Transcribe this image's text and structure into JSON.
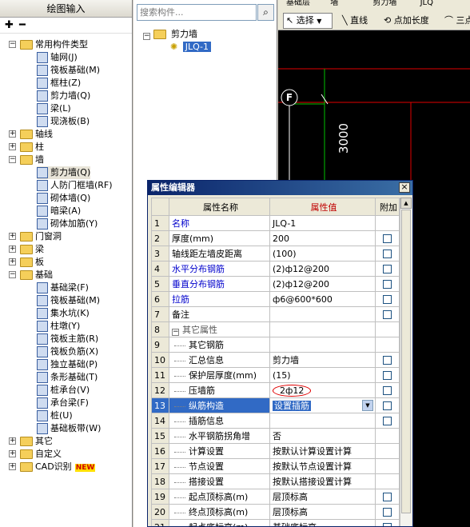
{
  "left_panel": {
    "title": "绘图输入",
    "tree": [
      {
        "level": 0,
        "type": "folder",
        "label": "常用构件类型",
        "expanded": true
      },
      {
        "level": 1,
        "type": "item",
        "label": "轴网(J)"
      },
      {
        "level": 1,
        "type": "item",
        "label": "筏板基础(M)"
      },
      {
        "level": 1,
        "type": "item",
        "label": "框柱(Z)"
      },
      {
        "level": 1,
        "type": "item",
        "label": "剪力墙(Q)"
      },
      {
        "level": 1,
        "type": "item",
        "label": "梁(L)"
      },
      {
        "level": 1,
        "type": "item",
        "label": "现浇板(B)"
      },
      {
        "level": 0,
        "type": "folder",
        "label": "轴线",
        "expanded": false
      },
      {
        "level": 0,
        "type": "folder",
        "label": "柱",
        "expanded": false
      },
      {
        "level": 0,
        "type": "folder",
        "label": "墙",
        "expanded": true
      },
      {
        "level": 1,
        "type": "item",
        "label": "剪力墙(Q)",
        "selected": true
      },
      {
        "level": 1,
        "type": "item",
        "label": "人防门框墙(RF)"
      },
      {
        "level": 1,
        "type": "item",
        "label": "砌体墙(Q)"
      },
      {
        "level": 1,
        "type": "item",
        "label": "暗梁(A)"
      },
      {
        "level": 1,
        "type": "item",
        "label": "砌体加筋(Y)"
      },
      {
        "level": 0,
        "type": "folder",
        "label": "门窗洞",
        "expanded": false
      },
      {
        "level": 0,
        "type": "folder",
        "label": "梁",
        "expanded": false
      },
      {
        "level": 0,
        "type": "folder",
        "label": "板",
        "expanded": false
      },
      {
        "level": 0,
        "type": "folder",
        "label": "基础",
        "expanded": true
      },
      {
        "level": 1,
        "type": "item",
        "label": "基础梁(F)"
      },
      {
        "level": 1,
        "type": "item",
        "label": "筏板基础(M)"
      },
      {
        "level": 1,
        "type": "item",
        "label": "集水坑(K)"
      },
      {
        "level": 1,
        "type": "item",
        "label": "柱墩(Y)"
      },
      {
        "level": 1,
        "type": "item",
        "label": "筏板主筋(R)"
      },
      {
        "level": 1,
        "type": "item",
        "label": "筏板负筋(X)"
      },
      {
        "level": 1,
        "type": "item",
        "label": "独立基础(P)"
      },
      {
        "level": 1,
        "type": "item",
        "label": "条形基础(T)"
      },
      {
        "level": 1,
        "type": "item",
        "label": "桩承台(V)"
      },
      {
        "level": 1,
        "type": "item",
        "label": "承台梁(F)"
      },
      {
        "level": 1,
        "type": "item",
        "label": "桩(U)"
      },
      {
        "level": 1,
        "type": "item",
        "label": "基础板带(W)"
      },
      {
        "level": 0,
        "type": "folder",
        "label": "其它",
        "expanded": false
      },
      {
        "level": 0,
        "type": "folder",
        "label": "自定义",
        "expanded": false
      },
      {
        "level": 0,
        "type": "folder",
        "label": "CAD识别",
        "expanded": false,
        "badge": "NEW"
      }
    ]
  },
  "search": {
    "placeholder": "搜索构件...",
    "tree_root": "剪力墙",
    "tree_child": "JLQ-1"
  },
  "cad_toolbar": {
    "top_fields": [
      "基础层",
      "墙",
      "剪力墙",
      "JLQ"
    ],
    "select_label": "选择",
    "line_label": "直线",
    "point_length_label": "点加长度",
    "three_point_label": "三点"
  },
  "cad": {
    "axis_label": "F",
    "dimension": "3000"
  },
  "property_dialog": {
    "title": "属性编辑器",
    "headers": [
      "属性名称",
      "属性值",
      "附加"
    ],
    "rows": [
      {
        "num": "1",
        "name": "名称",
        "value": "JLQ-1",
        "blue": true,
        "checkbox": false
      },
      {
        "num": "2",
        "name": "厚度(mm)",
        "value": "200",
        "blue": false,
        "checkbox": true
      },
      {
        "num": "3",
        "name": "轴线距左墙皮距离",
        "value": "(100)",
        "blue": false,
        "checkbox": true
      },
      {
        "num": "4",
        "name": "水平分布钢筋",
        "value": "(2)ф12@200",
        "blue": true,
        "checkbox": true
      },
      {
        "num": "5",
        "name": "垂直分布钢筋",
        "value": "(2)ф12@200",
        "blue": true,
        "checkbox": true
      },
      {
        "num": "6",
        "name": "拉筋",
        "value": "ф6@600*600",
        "blue": true,
        "checkbox": true
      },
      {
        "num": "7",
        "name": "备注",
        "value": "",
        "blue": false,
        "checkbox": true
      },
      {
        "num": "8",
        "name": "其它属性",
        "value": "",
        "blue": false,
        "gray": true,
        "group": true,
        "checkbox": false
      },
      {
        "num": "9",
        "name": "其它钢筋",
        "value": "",
        "blue": false,
        "indent": true,
        "checkbox": false
      },
      {
        "num": "10",
        "name": "汇总信息",
        "value": "剪力墙",
        "blue": false,
        "indent": true,
        "checkbox": true
      },
      {
        "num": "11",
        "name": "保护层厚度(mm)",
        "value": "(15)",
        "blue": false,
        "indent": true,
        "checkbox": true
      },
      {
        "num": "12",
        "name": "压墙筋",
        "value": "2ф12",
        "blue": false,
        "indent": true,
        "checkbox": true,
        "circled": true
      },
      {
        "num": "13",
        "name": "纵筋构造",
        "value": "设置插筋",
        "blue": false,
        "indent": true,
        "checkbox": true,
        "active": true
      },
      {
        "num": "14",
        "name": "插筋信息",
        "value": "",
        "blue": false,
        "indent": true,
        "checkbox": true
      },
      {
        "num": "15",
        "name": "水平钢筋拐角增",
        "value": "否",
        "blue": false,
        "indent": true,
        "checkbox": false
      },
      {
        "num": "16",
        "name": "计算设置",
        "value": "按默认计算设置计算",
        "blue": false,
        "indent": true,
        "checkbox": false
      },
      {
        "num": "17",
        "name": "节点设置",
        "value": "按默认节点设置计算",
        "blue": false,
        "indent": true,
        "checkbox": false
      },
      {
        "num": "18",
        "name": "搭接设置",
        "value": "按默认搭接设置计算",
        "blue": false,
        "indent": true,
        "checkbox": false
      },
      {
        "num": "19",
        "name": "起点顶标高(m)",
        "value": "层顶标高",
        "blue": false,
        "indent": true,
        "checkbox": true
      },
      {
        "num": "20",
        "name": "终点顶标高(m)",
        "value": "层顶标高",
        "blue": false,
        "indent": true,
        "checkbox": true
      },
      {
        "num": "21",
        "name": "起点底标高(m)",
        "value": "基础底标高",
        "blue": false,
        "indent": true,
        "checkbox": true
      }
    ]
  },
  "colors": {
    "title_bar": "#0a246a",
    "selected_row": "#316ac5",
    "header_value": "#c00000",
    "link_text": "#0000cc",
    "cad_background": "#000000",
    "cad_red": "#e00000",
    "cad_green": "#00c000"
  }
}
